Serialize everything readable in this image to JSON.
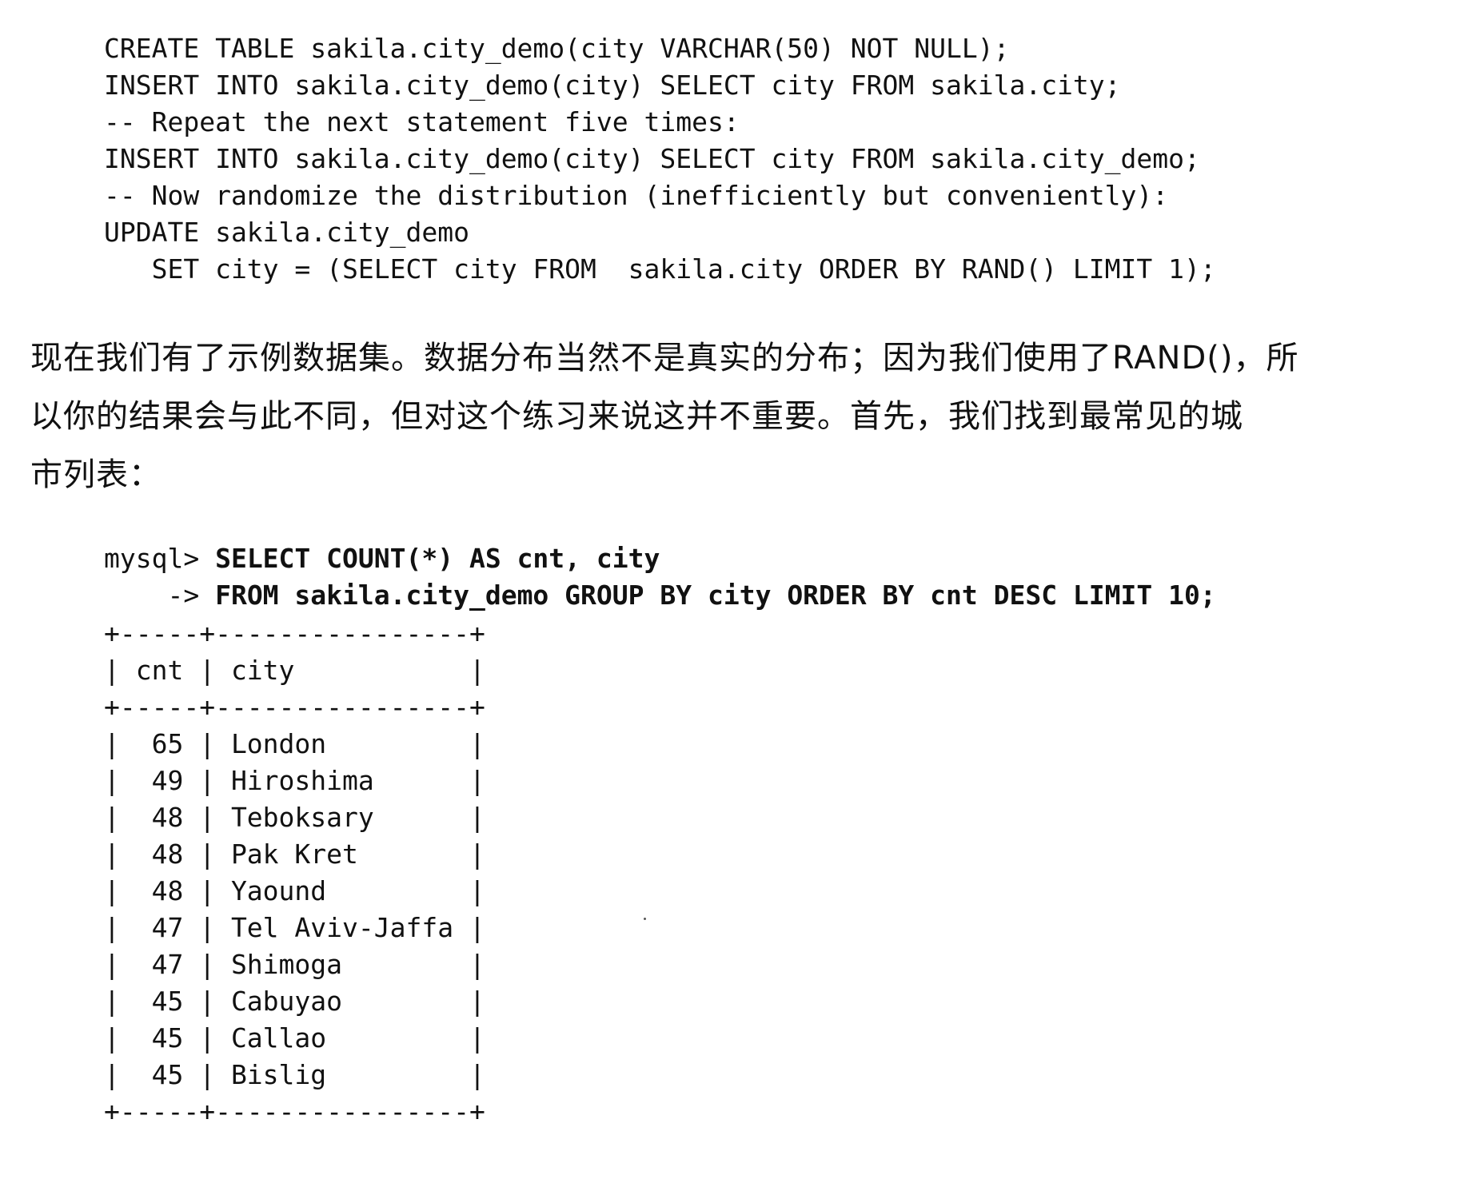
{
  "code_top": {
    "lines": [
      "CREATE TABLE sakila.city_demo(city VARCHAR(50) NOT NULL);",
      "INSERT INTO sakila.city_demo(city) SELECT city FROM sakila.city;",
      "-- Repeat the next statement five times:",
      "INSERT INTO sakila.city_demo(city) SELECT city FROM sakila.city_demo;",
      "-- Now randomize the distribution (inefficiently but conveniently):",
      "UPDATE sakila.city_demo",
      "   SET city = (SELECT city FROM  sakila.city ORDER BY RAND() LIMIT 1);"
    ]
  },
  "paragraph": {
    "lines": [
      "现在我们有了示例数据集。数据分布当然不是真实的分布；因为我们使用了RAND()，所",
      "以你的结果会与此不同，但对这个练习来说这并不重要。首先，我们找到最常见的城",
      "市列表："
    ]
  },
  "query": {
    "prompt1": "mysql> ",
    "line1": "SELECT COUNT(*) AS cnt, city",
    "prompt2": "    -> ",
    "line2": "FROM sakila.city_demo GROUP BY city ORDER BY cnt DESC LIMIT 10;"
  },
  "result": {
    "border": "+-----+----------------+",
    "header": "| cnt | city           |",
    "rows": [
      "|  65 | London         |",
      "|  49 | Hiroshima      |",
      "|  48 | Teboksary      |",
      "|  48 | Pak Kret       |",
      "|  48 | Yaound         |",
      "|  47 | Tel Aviv-Jaffa |",
      "|  47 | Shimoga        |",
      "|  45 | Cabuyao        |",
      "|  45 | Callao         |",
      "|  45 | Bislig         |"
    ]
  }
}
